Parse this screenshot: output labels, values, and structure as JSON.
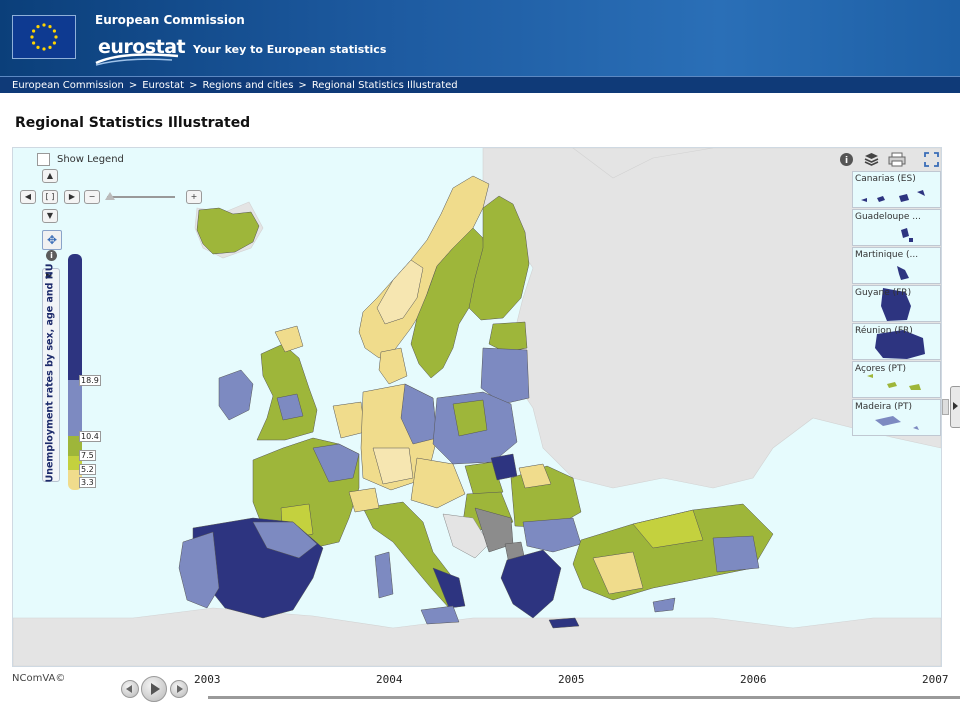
{
  "header": {
    "org": "European Commission",
    "brand": "eurostat",
    "tagline": "Your key to European statistics"
  },
  "breadcrumb": [
    "European Commission",
    "Eurostat",
    "Regions and cities",
    "Regional Statistics Illustrated"
  ],
  "page_title": "Regional Statistics Illustrated",
  "map": {
    "show_legend_label": "Show Legend",
    "indicator_label": "Unemployment rates by sex, age and NU",
    "legend_breaks": [
      "18.9",
      "10.4",
      "7.5",
      "5.2",
      "3.3"
    ],
    "legend_colors": [
      "#2d3480",
      "#7d8ac1",
      "#9eb63a",
      "#c4d13e",
      "#f0dc8c"
    ],
    "insets": [
      {
        "label": "Canarias (ES)"
      },
      {
        "label": "Guadeloupe ..."
      },
      {
        "label": "Martinique (..."
      },
      {
        "label": "Guyane (FR)"
      },
      {
        "label": "Réunion (FR)"
      },
      {
        "label": "Açores (PT)"
      },
      {
        "label": "Madeira (PT)"
      }
    ],
    "credit": "NComVA©"
  },
  "timeline": {
    "years": [
      "2003",
      "2004",
      "2005",
      "2006",
      "2007"
    ]
  },
  "colors": {
    "sea": "#e6fbfd",
    "non_eu_land": "#e4e4e4",
    "no_data": "#8c8c8c"
  }
}
